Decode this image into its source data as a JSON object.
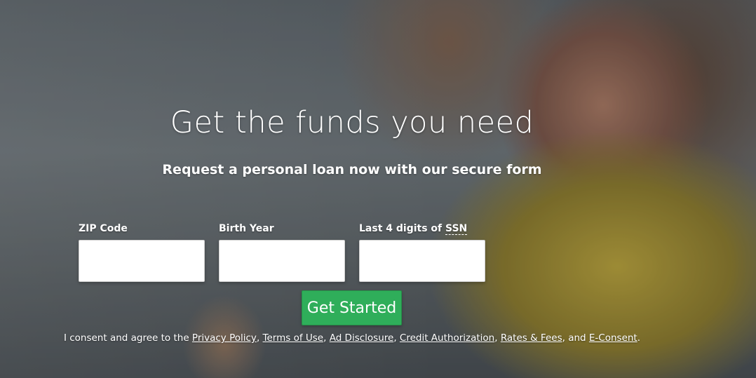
{
  "hero": {
    "headline": "Get the funds you need",
    "subheadline": "Request a personal loan now with our secure form"
  },
  "form": {
    "zip": {
      "label": "ZIP Code",
      "value": "",
      "placeholder": ""
    },
    "birth_year": {
      "label": "Birth Year",
      "value": "",
      "placeholder": ""
    },
    "ssn": {
      "label_prefix": "Last 4 digits of ",
      "label_abbr": "SSN",
      "value": "",
      "placeholder": ""
    },
    "submit_label": "Get Started"
  },
  "consent": {
    "prefix": "I consent and agree to the ",
    "links": [
      "Privacy Policy",
      "Terms of Use",
      "Ad Disclosure",
      "Credit Authorization",
      "Rates & Fees",
      "E-Consent"
    ],
    "separator": ", ",
    "and_text": ", and ",
    "suffix": "."
  },
  "colors": {
    "button": "#2fae5a",
    "text": "#ffffff"
  }
}
